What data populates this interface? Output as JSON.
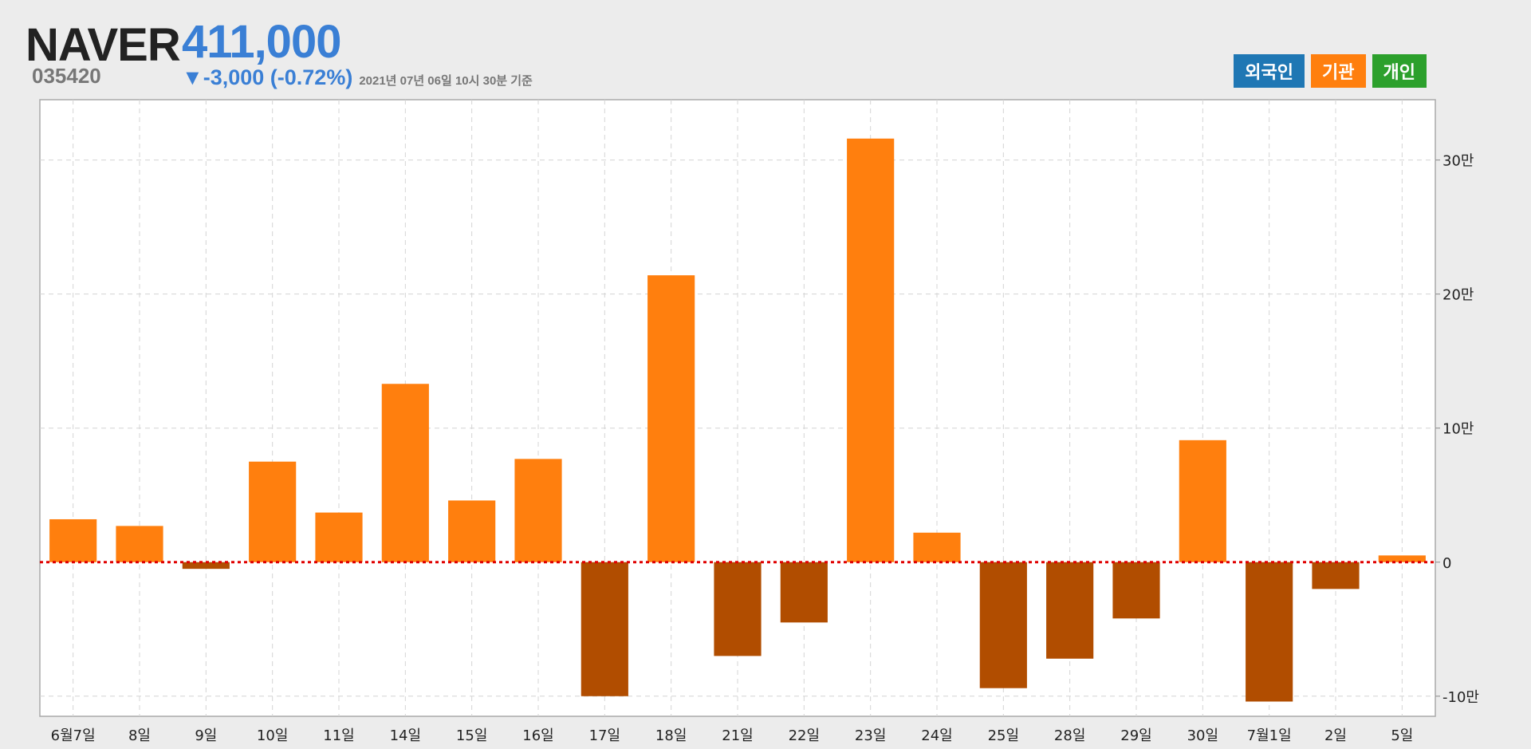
{
  "header": {
    "name": "NAVER",
    "code": "035420",
    "price": "411,000",
    "change": "▼-3,000 (-0.72%)",
    "as_of": "2021년 07년 06일 10시 30분 기준"
  },
  "legend": {
    "items": [
      {
        "label": "외국인",
        "color": "#1f77b4"
      },
      {
        "label": "기관",
        "color": "#ff7f0e"
      },
      {
        "label": "개인",
        "color": "#2ca02c"
      }
    ]
  },
  "colors": {
    "positive": "#ff7f0e",
    "negative": "#b14d00",
    "zero_line": "#e00000",
    "grid": "#d4d4d4"
  },
  "chart_data": {
    "type": "bar",
    "series": [
      {
        "name": "기관",
        "values": [
          32000,
          27000,
          -5000,
          75000,
          37000,
          133000,
          46000,
          77000,
          -100000,
          214000,
          -70000,
          -45000,
          316000,
          22000,
          -94000,
          -72000,
          -42000,
          91000,
          -104000,
          -20000,
          5000
        ]
      }
    ],
    "categories": [
      "6월7일",
      "8일",
      "9일",
      "10일",
      "11일",
      "14일",
      "15일",
      "16일",
      "17일",
      "18일",
      "21일",
      "22일",
      "23일",
      "24일",
      "25일",
      "28일",
      "29일",
      "30일",
      "7월1일",
      "2일",
      "5일"
    ],
    "y_ticks": [
      -100000,
      0,
      100000,
      200000,
      300000
    ],
    "y_tick_labels": [
      "-10만",
      "0",
      "10만",
      "20만",
      "30만"
    ],
    "ylim": [
      -115000,
      345000
    ],
    "grid": true,
    "y_axis_position": "right"
  }
}
